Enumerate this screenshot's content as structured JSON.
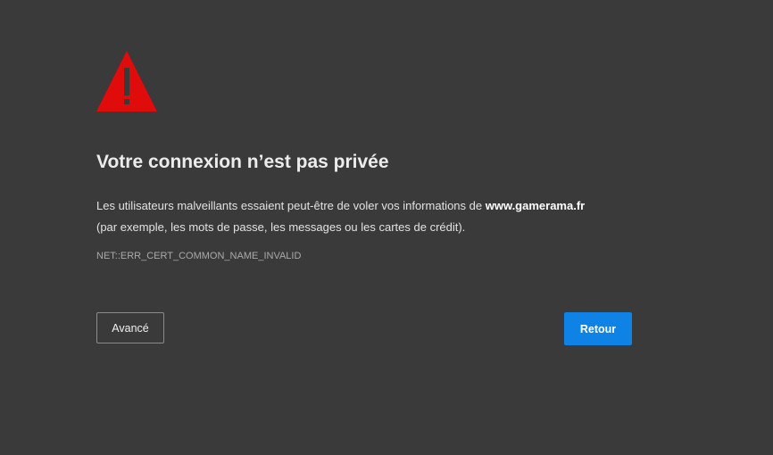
{
  "error_page": {
    "icon": "warning-triangle-icon",
    "icon_color": "#e00b0b",
    "title": "Votre connexion n’est pas privée",
    "message_prefix": "Les utilisateurs malveillants essaient peut-être de voler vos informations de ",
    "host": "www.gamerama.fr",
    "message_suffix": "(par exemple, les mots de passe, les messages ou les cartes de crédit).",
    "error_code": "NET::ERR_CERT_COMMON_NAME_INVALID"
  },
  "actions": {
    "advanced_label": "Avancé",
    "back_label": "Retour",
    "back_color": "#0f82e6"
  },
  "colors": {
    "background": "#3a3a3a"
  }
}
